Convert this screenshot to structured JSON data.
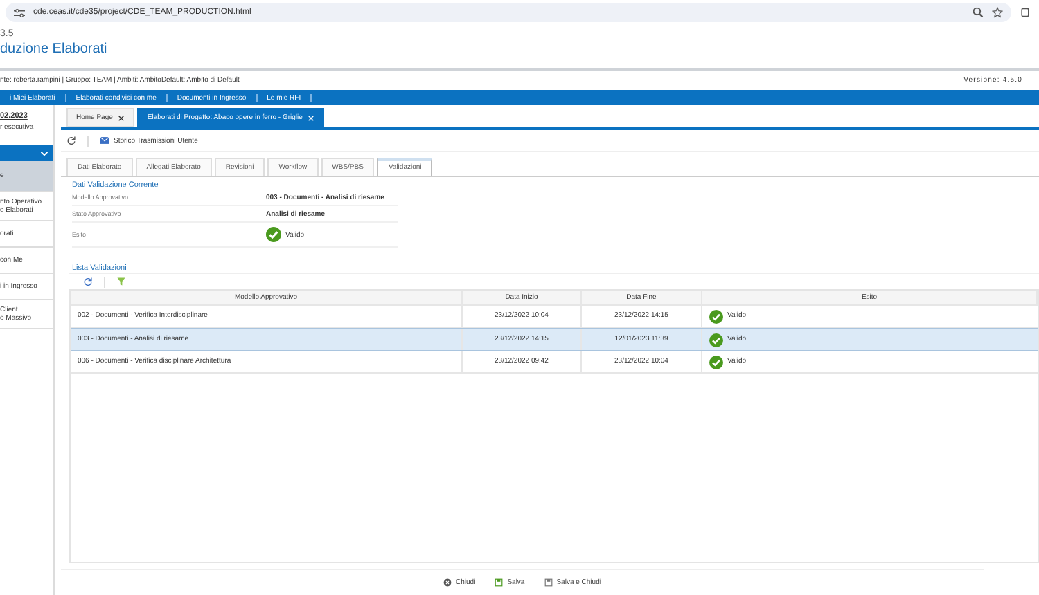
{
  "browser": {
    "url": "cde.ceas.it/cde35/project/CDE_TEAM_PRODUCTION.html"
  },
  "header": {
    "version_short": "3.5",
    "title": "duzione Elaborati",
    "version": "Versione: 4.5.0",
    "user_line": "nte: roberta.rampini | Gruppo: TEAM | Ambiti: AmbitoDefault: Ambito di Default"
  },
  "nav": [
    "i Miei Elaborati",
    "Elaborati condivisi con me",
    "Documenti in Ingresso",
    "Le mie RFI"
  ],
  "sidebar": {
    "date": "02.2023",
    "subtitle": "r esecutiva",
    "items": [
      {
        "lines": [
          "e"
        ],
        "selected": true
      },
      {
        "lines": [
          "nto Operativo",
          "e Elaborati"
        ],
        "selected": false
      },
      {
        "lines": [
          "orati"
        ],
        "selected": false
      },
      {
        "lines": [
          "con Me"
        ],
        "selected": false
      },
      {
        "lines": [
          "i in Ingresso"
        ],
        "selected": false
      },
      {
        "lines": [
          "Client",
          "o Massivo"
        ],
        "selected": false
      }
    ]
  },
  "doc_tabs": [
    {
      "label": "Home Page",
      "selected": false
    },
    {
      "label": "Elaborati di Progetto: Abaco opere in ferro - Griglie",
      "selected": true
    }
  ],
  "toolbar": {
    "history": "Storico Trasmissioni Utente"
  },
  "tabs": [
    {
      "label": "Dati Elaborato",
      "selected": false
    },
    {
      "label": "Allegati Elaborato",
      "selected": false
    },
    {
      "label": "Revisioni",
      "selected": false
    },
    {
      "label": "Workflow",
      "selected": false
    },
    {
      "label": "WBS/PBS",
      "selected": false
    },
    {
      "label": "Validazioni",
      "selected": true
    }
  ],
  "current": {
    "title": "Dati Validazione Corrente",
    "fields": [
      {
        "label": "Modello Approvativo",
        "value": "003 - Documenti - Analisi di riesame",
        "kind": "text"
      },
      {
        "label": "Stato Approvativo",
        "value": "Analisi di riesame",
        "kind": "text"
      },
      {
        "label": "Esito",
        "value": "Valido",
        "kind": "status"
      }
    ]
  },
  "list": {
    "title": "Lista Validazioni",
    "columns": [
      "Modello Approvativo",
      "Data Inizio",
      "Data Fine",
      "Esito"
    ],
    "rows": [
      {
        "model": "002 - Documenti - Verifica Interdisciplinare",
        "start": "23/12/2022 10:04",
        "end": "23/12/2022 14:15",
        "result": "Valido",
        "selected": false
      },
      {
        "model": "003 - Documenti - Analisi di riesame",
        "start": "23/12/2022 14:15",
        "end": "12/01/2023 11:39",
        "result": "Valido",
        "selected": true
      },
      {
        "model": "006 - Documenti - Verifica disciplinare Architettura",
        "start": "23/12/2022 09:42",
        "end": "23/12/2022 10:04",
        "result": "Valido",
        "selected": false
      }
    ]
  },
  "footer": [
    {
      "label": "Chiudi",
      "kind": "close"
    },
    {
      "label": "Salva",
      "kind": "save"
    },
    {
      "label": "Salva e Chiudi",
      "kind": "save-close"
    }
  ]
}
